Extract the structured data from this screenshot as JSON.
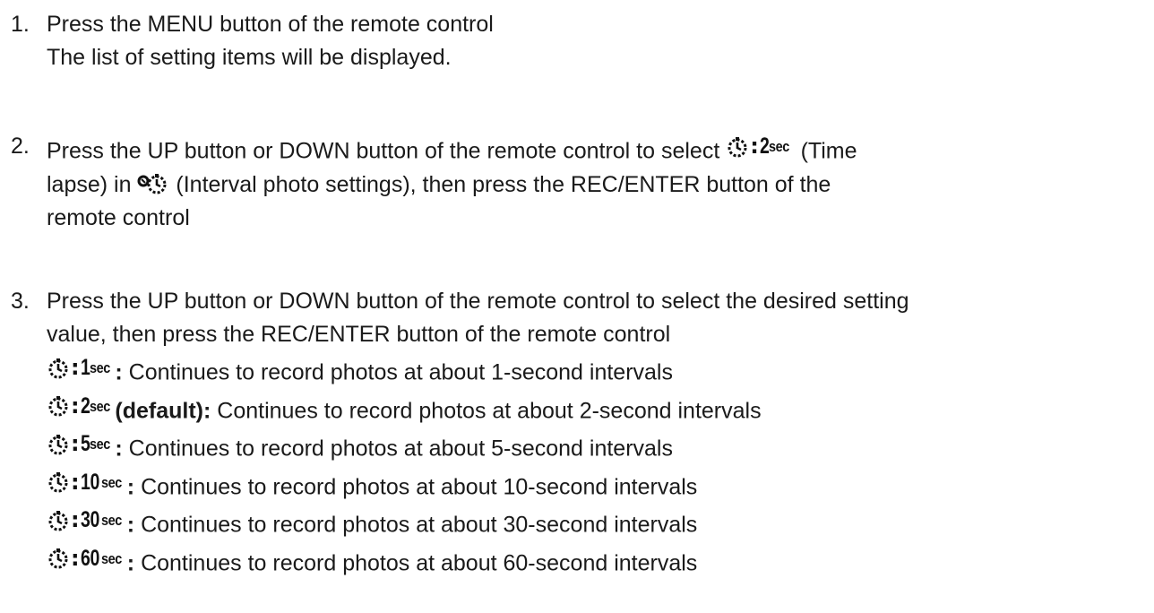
{
  "steps": [
    {
      "number": "1.",
      "line1": "Press the MENU button of the remote control",
      "line2": "The list of setting items will be displayed."
    },
    {
      "number": "2.",
      "part_a": "Press the UP button or DOWN button of the remote control to select ",
      "inline_badge": {
        "value": "2",
        "unit": "sec"
      },
      "part_b": " (Time",
      "part_c": "lapse) in ",
      "part_d": " (Interval photo settings), then press the REC/ENTER button of the",
      "part_e": "remote control"
    },
    {
      "number": "3.",
      "line1": "Press the UP button or DOWN button of the remote control to select the desired setting",
      "line2": "value, then press the REC/ENTER button of the remote control",
      "options": [
        {
          "value": "1",
          "unit": "sec",
          "suffix": ":",
          "desc": " Continues to record photos at about 1-second intervals"
        },
        {
          "value": "2",
          "unit": "sec",
          "suffix": "(default):",
          "desc": " Continues to record photos at about 2-second intervals"
        },
        {
          "value": "5",
          "unit": "sec",
          "suffix": ":",
          "desc": " Continues to record photos at about 5-second intervals"
        },
        {
          "value": "10",
          "unit": "sec",
          "suffix": ":",
          "desc": " Continues to record photos at about 10-second intervals"
        },
        {
          "value": "30",
          "unit": "sec",
          "suffix": ":",
          "desc": " Continues to record photos at about 30-second intervals"
        },
        {
          "value": "60",
          "unit": "sec",
          "suffix": ":",
          "desc": " Continues to record photos at about 60-second intervals"
        }
      ]
    }
  ],
  "icons": {
    "timelapse": "timelapse-timer-icon",
    "interval_settings": "interval-photo-settings-icon"
  }
}
